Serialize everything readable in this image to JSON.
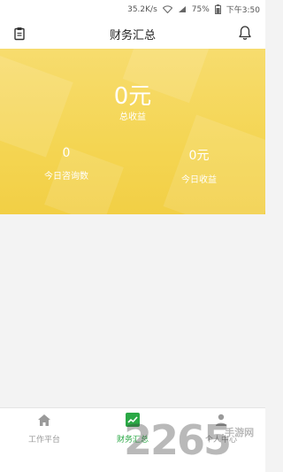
{
  "status_bar": {
    "network_speed": "35.2K/s",
    "battery": "75%",
    "time": "下午3:50"
  },
  "header": {
    "title": "财务汇总"
  },
  "summary": {
    "total_value": "0元",
    "total_label": "总收益",
    "consult_value": "0",
    "consult_label": "今日咨询数",
    "income_value": "0元",
    "income_label": "今日收益"
  },
  "nav": {
    "items": [
      {
        "label": "工作平台",
        "icon": "home-icon",
        "active": false
      },
      {
        "label": "财务汇总",
        "icon": "trend-chart-icon",
        "active": true
      },
      {
        "label": "个人中心",
        "icon": "user-icon",
        "active": false
      }
    ]
  },
  "colors": {
    "banner": "#f4d552",
    "active": "#2aa845",
    "inactive": "#999999"
  },
  "watermark": {
    "number": "2265",
    "suffix": ".手游网"
  }
}
